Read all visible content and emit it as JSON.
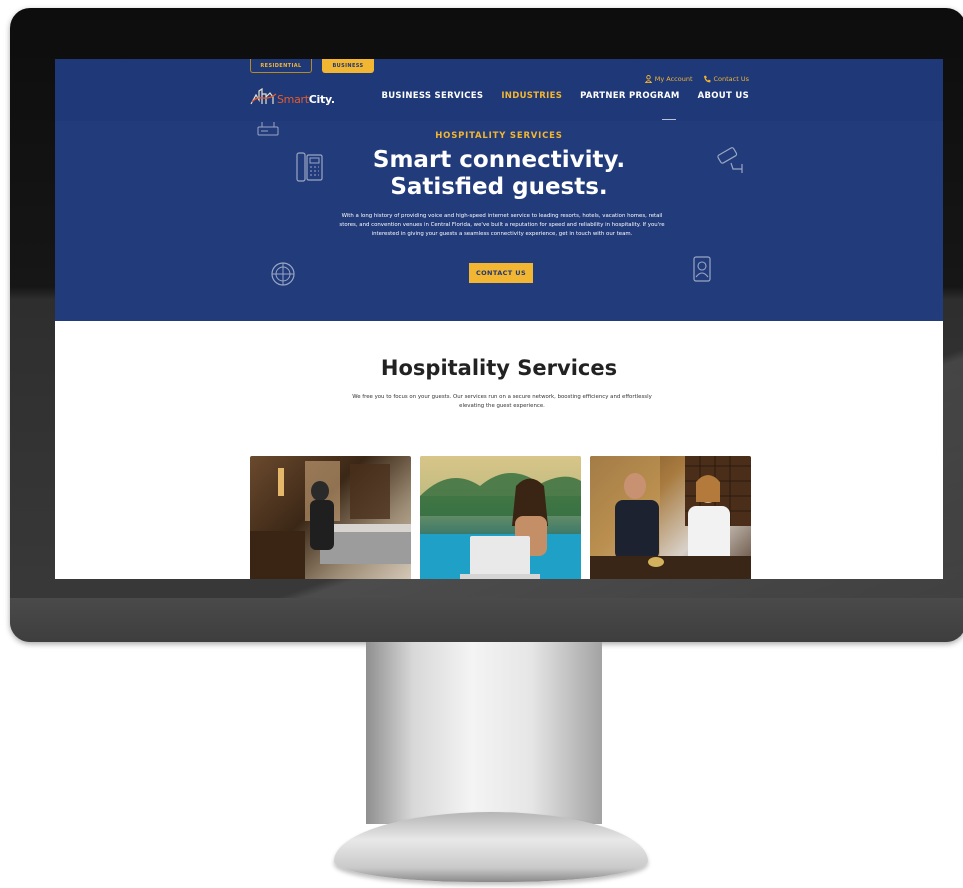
{
  "colors": {
    "hero_bg": "#213b7b",
    "accent_yellow": "#f2b632",
    "logo_orange": "#e55b2d",
    "text_dark": "#222222"
  },
  "site_toggle": {
    "residential": "RESIDENTIAL",
    "business": "BUSINESS"
  },
  "logo": {
    "smart": "Smart",
    "city": "City."
  },
  "utility_links": {
    "account": "My Account",
    "contact": "Contact Us"
  },
  "nav": {
    "items": [
      {
        "label": "BUSINESS SERVICES",
        "active": false
      },
      {
        "label": "INDUSTRIES",
        "active": true
      },
      {
        "label": "PARTNER PROGRAM",
        "active": false
      },
      {
        "label": "ABOUT US",
        "active": false
      }
    ]
  },
  "hero": {
    "eyebrow": "HOSPITALITY SERVICES",
    "title_line1": "Smart connectivity.",
    "title_line2": "Satisfied guests.",
    "body": "With a long history of providing voice and high-speed internet service to leading resorts, hotels, vacation homes, retail stores, and convention venues in Central Florida, we've built a reputation for speed and reliability in hospitality. If you're interested in giving your guests a seamless connectivity experience, get in touch with our team.",
    "cta": "CONTACT US",
    "icons": [
      "router-icon",
      "phone-icon",
      "security-camera-icon",
      "globe-icon",
      "person-badge-icon"
    ]
  },
  "services": {
    "title": "Hospitality Services",
    "subtitle": "We free you to focus on your guests. Our services run on a secure network, boosting efficiency and effortlessly elevating the guest experience."
  },
  "cards": [
    {
      "image": "hotel-room-photo"
    },
    {
      "image": "poolside-laptop-photo"
    },
    {
      "image": "hotel-front-desk-photo"
    }
  ]
}
